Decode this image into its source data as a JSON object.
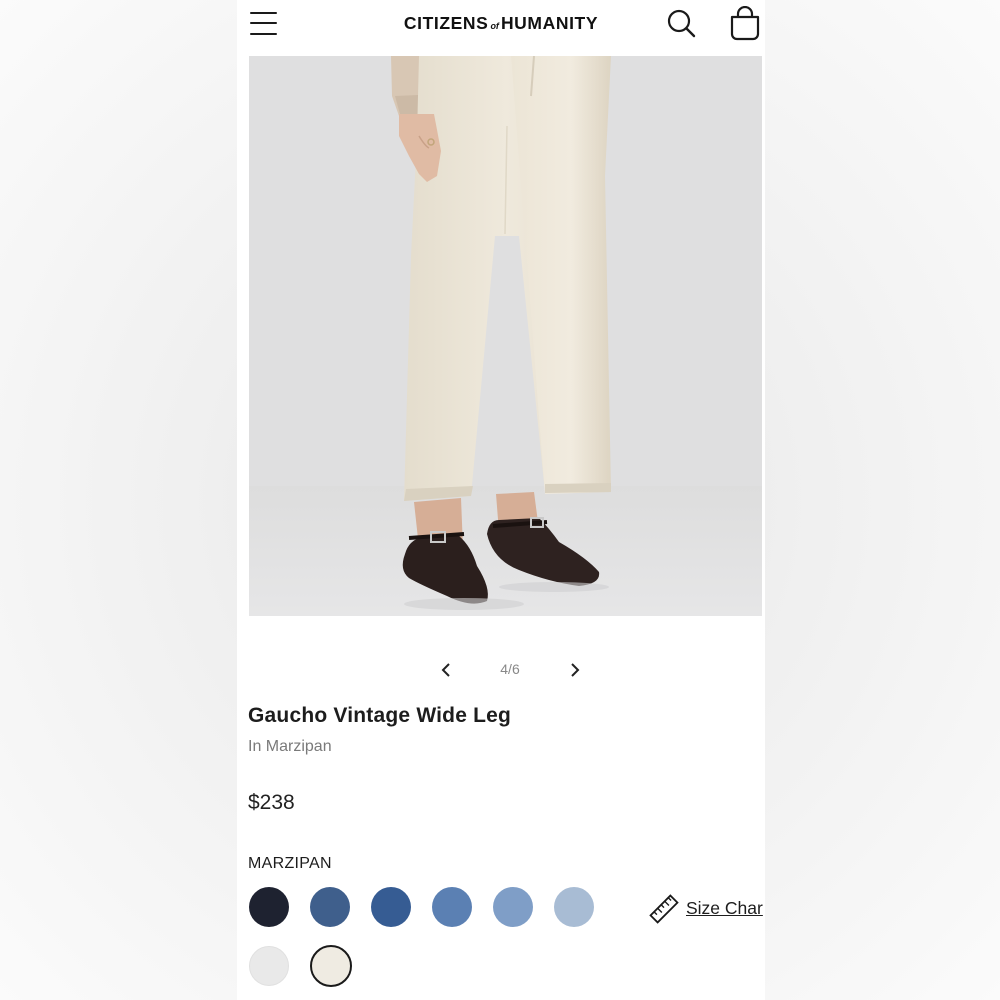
{
  "header": {
    "logo_left": "CITIZENS",
    "logo_mid": "of",
    "logo_right": "HUMANITY",
    "icons": [
      "menu-icon",
      "search-icon",
      "bag-icon"
    ]
  },
  "gallery": {
    "current": "4/6",
    "icons": [
      "chevron-left-icon",
      "chevron-right-icon"
    ]
  },
  "product": {
    "title": "Gaucho Vintage Wide Leg",
    "subtitle": "In Marzipan",
    "price": "$238"
  },
  "colors": {
    "selected_label": "MARZIPAN",
    "swatches": [
      {
        "color": "#1e2230"
      },
      {
        "color": "#3f5f8c"
      },
      {
        "color": "#365c93"
      },
      {
        "color": "#5b80b3"
      },
      {
        "color": "#7f9ec7"
      },
      {
        "color": "#a8bcd4"
      },
      {
        "color": "#e9e9e9"
      },
      {
        "color": "#efebe2",
        "selected": true
      }
    ]
  },
  "size_chart": {
    "label": "Size Char",
    "icon": "ruler-icon"
  }
}
